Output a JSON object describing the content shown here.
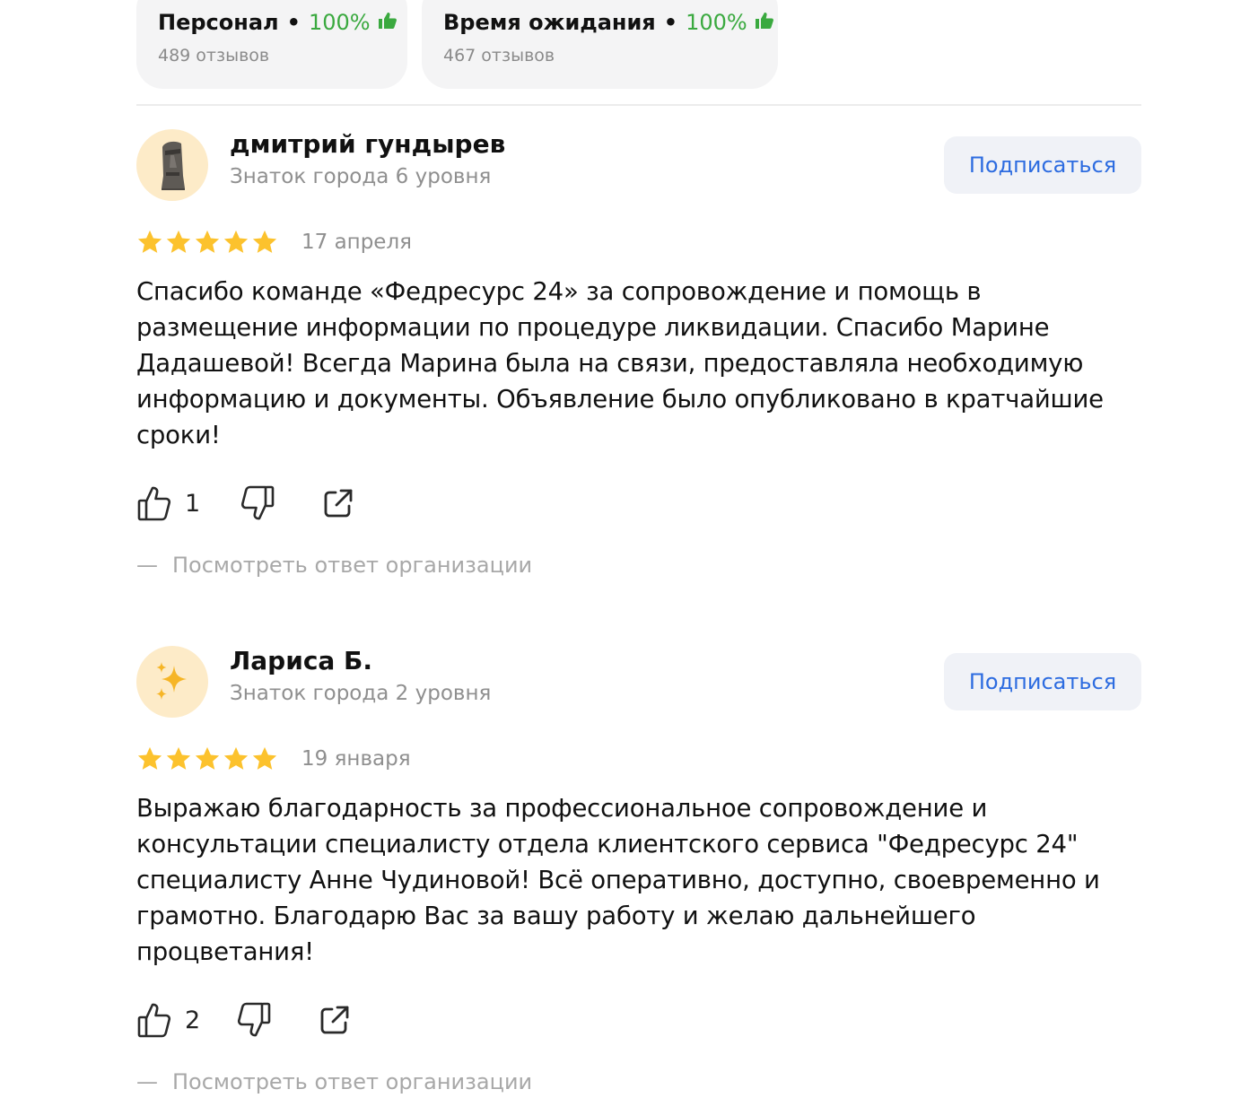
{
  "summary_chips": [
    {
      "label": "Персонал",
      "percent": "100%",
      "count": "489 отзывов"
    },
    {
      "label": "Время ожидания",
      "percent": "100%",
      "count": "467 отзывов"
    }
  ],
  "reviews": [
    {
      "author": "дмитрий гундырев",
      "level": "Знаток города 6 уровня",
      "avatar_icon": "moai-icon",
      "subscribe_label": "Подписаться",
      "rating": 5,
      "date": "17 апреля",
      "text": "Спасибо команде «Федресурс 24» за сопровождение и помощь в размещение информации по процедуре ликвидации. Спасибо Марине Дадашевой! Всегда Марина была на связи, предоставляла необходимую информацию и документы. Объявление было опубликовано в кратчайшие сроки!",
      "likes": "1",
      "reply_link": "Посмотреть ответ организации"
    },
    {
      "author": "Лариса Б.",
      "level": "Знаток города 2 уровня",
      "avatar_icon": "sparkles-icon",
      "subscribe_label": "Подписаться",
      "rating": 5,
      "date": "19 января",
      "text": "Выражаю благодарность за профессиональное сопровождение и консультации специалисту отдела клиентского сервиса \"Федресурс 24\" специалисту Анне Чудиновой! Всё оперативно, доступно, своевременно и грамотно. Благодарю Вас за вашу работу и желаю дальнейшего процветания!",
      "likes": "2",
      "reply_link": "Посмотреть ответ организации"
    }
  ],
  "colors": {
    "accent": "#2d6ce0",
    "positive": "#3aa93f",
    "star": "#fcc22d",
    "muted": "#8f8f8f"
  }
}
